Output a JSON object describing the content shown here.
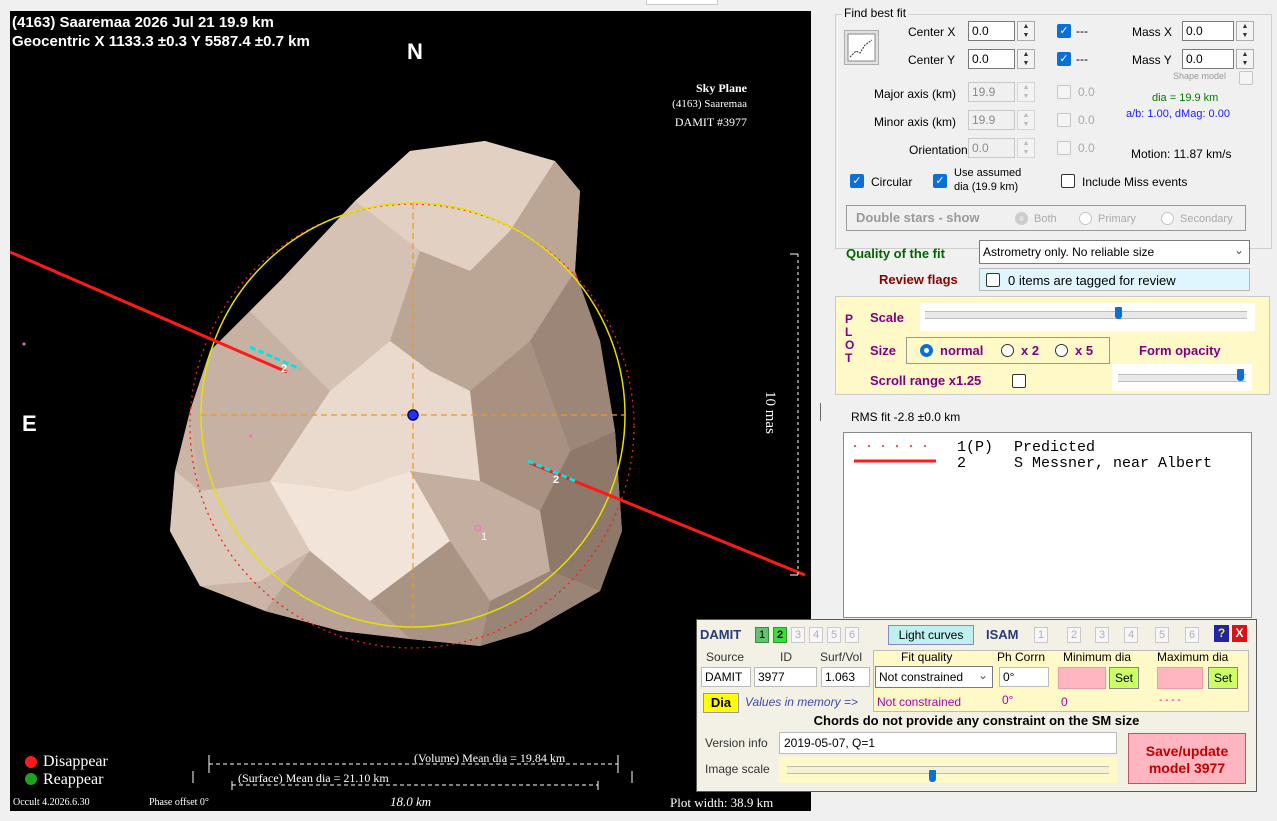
{
  "plot": {
    "title_line1": "(4163) Saaremaa  2026 Jul 21   19.9 km",
    "title_line2": "Geocentric  X  1133.3 ±0.3  Y  5587.4 ±0.7 km",
    "north_label": "N",
    "east_label": "E",
    "sky_plane_title": "Sky Plane",
    "sky_plane_object": "(4163) Saaremaa",
    "sky_plane_damit": "DAMIT #3977",
    "scale_label": "10 mas",
    "volume_dia": "(Volume) Mean dia = 19.84 km",
    "surface_dia": "(Surface) Mean dia = 21.10 km",
    "scale_km": "18.0 km",
    "disappear": "Disappear",
    "reappear": "Reappear",
    "version": "Occult 4.2026.6.30",
    "phase_offset": "Phase offset 0°",
    "plot_width": "Plot width: 38.9 km",
    "chord_label_a": "2",
    "chord_label_b": "2",
    "predicted_label": "1"
  },
  "fit": {
    "title": "Find best fit",
    "center_x_label": "Center X",
    "center_x_value": "0.0",
    "center_y_label": "Center Y",
    "center_y_value": "0.0",
    "center_x_check_label": "---",
    "center_y_check_label": "---",
    "mass_x_label": "Mass X",
    "mass_x_value": "0.0",
    "mass_y_label": "Mass Y",
    "mass_y_value": "0.0",
    "shape_model_label": "Shape model",
    "major_axis_label": "Major axis (km)",
    "major_axis_value": "19.9",
    "major_axis_check": "0.0",
    "minor_axis_label": "Minor axis (km)",
    "minor_axis_value": "19.9",
    "minor_axis_check": "0.0",
    "orientation_label": "Orientation",
    "orientation_value": "0.0",
    "orientation_check": "0.0",
    "dia_text": "dia = 19.9 km",
    "ab_text": "a/b: 1.00, dMag: 0.00",
    "motion_text": "Motion: 11.87 km/s",
    "circular_label": "Circular",
    "use_assumed_label_1": "Use assumed",
    "use_assumed_label_2": "dia (19.9 km)",
    "include_miss_label": "Include Miss events",
    "double_stars_label": "Double stars - show",
    "both_label": "Both",
    "primary_label": "Primary",
    "secondary_label": "Secondary",
    "quality_label": "Quality of the fit",
    "quality_value": "Astrometry only. No reliable size",
    "review_label": "Review flags",
    "review_value": "0 items are tagged for review"
  },
  "plotpanel": {
    "plot_letters": [
      "P",
      "L",
      "O",
      "T"
    ],
    "scale_label": "Scale",
    "scale_value": 0.6,
    "size_label": "Size",
    "size_normal": "normal",
    "size_x2": "x 2",
    "size_x5": "x 5",
    "form_opacity_label": "Form opacity",
    "opacity_value": 0.95,
    "scroll_label": "Scroll range x1.25"
  },
  "rms": "RMS fit -2.8 ±0.0 km",
  "legend": [
    {
      "num": "1(P)",
      "name": "Predicted"
    },
    {
      "num": "2",
      "name": "S Messner, near Albert"
    }
  ],
  "damit": {
    "damit_label": "DAMIT",
    "tabs": [
      "1",
      "2",
      "3",
      "4",
      "5",
      "6"
    ],
    "light_curves_label": "Light curves",
    "isam_label": "ISAM",
    "isam_tabs": [
      "1",
      "2",
      "3",
      "4",
      "5",
      "6"
    ],
    "help_label": "?",
    "close_label": "X",
    "source_head": "Source",
    "id_head": "ID",
    "surfvol_head": "Surf/Vol",
    "fit_quality_head": "Fit quality",
    "ph_corrn_head": "Ph Corrn",
    "min_dia_head": "Minimum dia",
    "max_dia_head": "Maximum dia",
    "source_value": "DAMIT",
    "id_value": "3977",
    "surfvol_value": "1.063",
    "fit_quality_value": "Not constrained",
    "ph_corrn_value": "0°",
    "set_label": "Set",
    "dia_button": "Dia",
    "values_memory_label": "Values in memory =>",
    "mem_fit_quality": "Not constrained",
    "mem_ph_corrn": "0°",
    "mem_min_dia": "0",
    "mem_max_dia": "- - - -",
    "chords_note": "Chords do not provide any constraint on the SM size",
    "version_label": "Version info",
    "version_value": "2019-05-07, Q=1",
    "image_scale_label": "Image scale",
    "image_scale_value": 0.45,
    "save_label_1": "Save/update",
    "save_label_2": "model 3977"
  },
  "colors": {
    "plot_bg": "#000000",
    "asteroid_light": "#d8c4b6",
    "circle": "#e8e000",
    "chord": "#ff1a1a",
    "chord_tick": "#00e6e6",
    "quality_green": "#006400",
    "review_red": "#8b0000",
    "plot_panel": "#fff9c8",
    "purple": "#800080",
    "save_pink": "#ffb6c1"
  }
}
